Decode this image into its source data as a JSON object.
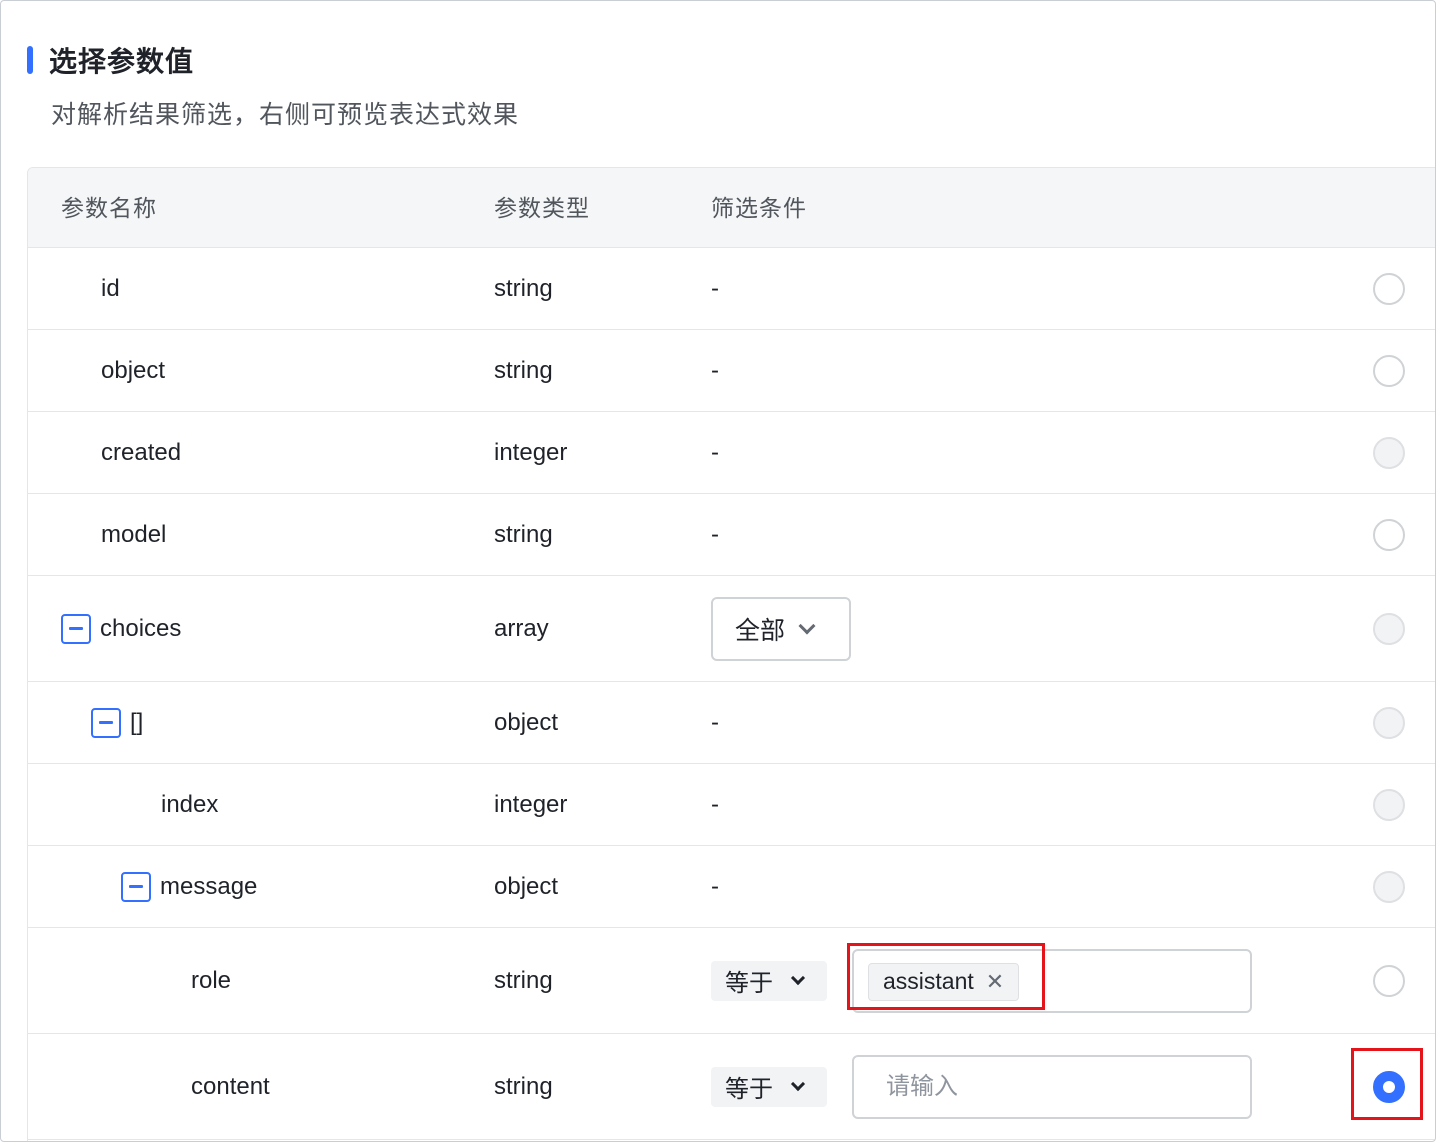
{
  "section": {
    "title": "选择参数值",
    "description": "对解析结果筛选，右侧可预览表达式效果",
    "accent_color": "#3370ff"
  },
  "table": {
    "columns": [
      "参数名称",
      "参数类型",
      "筛选条件"
    ],
    "rows": [
      {
        "name": "id",
        "type": "string",
        "filter": "-",
        "radio": "unselected"
      },
      {
        "name": "object",
        "type": "string",
        "filter": "-",
        "radio": "unselected"
      },
      {
        "name": "created",
        "type": "integer",
        "filter": "-",
        "radio": "disabled"
      },
      {
        "name": "model",
        "type": "string",
        "filter": "-",
        "radio": "unselected"
      },
      {
        "name": "choices",
        "type": "array",
        "filter_select": "全部",
        "radio": "disabled",
        "collapse_icon": "minus-square-icon"
      },
      {
        "name": "[]",
        "type": "object",
        "filter": "-",
        "radio": "disabled",
        "collapse_icon": "minus-square-icon"
      },
      {
        "name": "index",
        "type": "integer",
        "filter": "-",
        "radio": "disabled"
      },
      {
        "name": "message",
        "type": "object",
        "filter": "-",
        "radio": "disabled",
        "collapse_icon": "minus-square-icon"
      },
      {
        "name": "role",
        "type": "string",
        "operator": "等于",
        "tag_value": "assistant",
        "radio": "unselected"
      },
      {
        "name": "content",
        "type": "string",
        "operator": "等于",
        "placeholder": "请输入",
        "radio": "selected"
      }
    ]
  },
  "highlight_color": "#e5141b"
}
